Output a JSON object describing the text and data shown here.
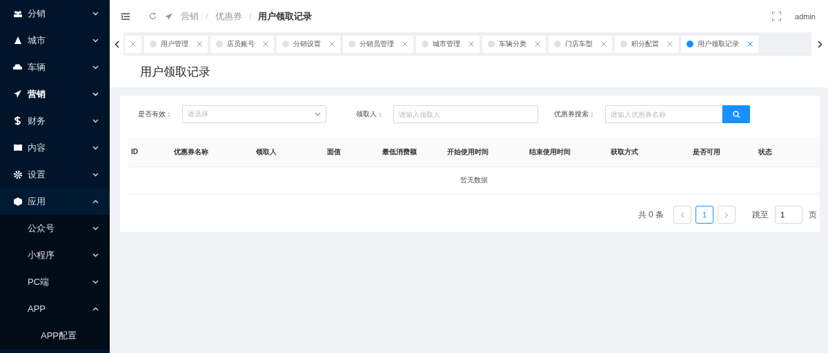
{
  "sidebar": {
    "items": [
      {
        "label": "分销",
        "expanded": false,
        "selected": false
      },
      {
        "label": "城市",
        "expanded": false,
        "selected": false
      },
      {
        "label": "车辆",
        "expanded": false,
        "selected": false
      },
      {
        "label": "营销",
        "expanded": false,
        "selected": true
      },
      {
        "label": "财务",
        "expanded": false,
        "selected": false
      },
      {
        "label": "内容",
        "expanded": false,
        "selected": false
      },
      {
        "label": "设置",
        "expanded": false,
        "selected": false
      },
      {
        "label": "应用",
        "expanded": true,
        "selected": false,
        "children": [
          {
            "label": "公众号",
            "expanded": false,
            "selected": false
          },
          {
            "label": "小程序",
            "expanded": false,
            "selected": false
          },
          {
            "label": "PC端",
            "expanded": false,
            "selected": false
          },
          {
            "label": "APP",
            "expanded": true,
            "selected": false,
            "children": [
              {
                "label": "APP配置",
                "selected": false
              }
            ]
          }
        ]
      }
    ]
  },
  "header": {
    "breadcrumb": [
      "营销",
      "优惠券",
      "用户领取记录"
    ],
    "separators": [
      "/",
      "/"
    ],
    "user": "admin"
  },
  "tabs": [
    {
      "selected": false
    },
    {
      "label": "用户管理",
      "selected": false
    },
    {
      "label": "店员账号",
      "selected": false
    },
    {
      "label": "分销设置",
      "selected": false
    },
    {
      "label": "分销员管理",
      "selected": false
    },
    {
      "label": "城市管理",
      "selected": false
    },
    {
      "label": "车辆分类",
      "selected": false
    },
    {
      "label": "门店车型",
      "selected": false
    },
    {
      "label": "积分配置",
      "selected": false
    },
    {
      "label": "用户领取记录",
      "selected": true
    }
  ],
  "page": {
    "title": "用户领取记录"
  },
  "filters": [
    {
      "kind": "select",
      "label": "是否有效：",
      "placeholder": "请选择"
    },
    {
      "kind": "input",
      "label": "领取人：",
      "placeholder": "请输入领取人"
    },
    {
      "kind": "search",
      "label": "优惠券搜索：",
      "placeholder": "请输入优惠券名称"
    }
  ],
  "table": {
    "columns": [
      "ID",
      "优惠券名称",
      "领取人",
      "面值",
      "最低消费额",
      "开始使用时间",
      "结束使用时间",
      "获取方式",
      "是否可用",
      "状态"
    ],
    "empty_text": "暂无数据"
  },
  "pagination": {
    "total": "共 0 条",
    "pages": [
      {
        "label": "1",
        "selected": true
      }
    ],
    "jump_label": "跳至",
    "jump_value": "1",
    "page_suffix": "页"
  }
}
